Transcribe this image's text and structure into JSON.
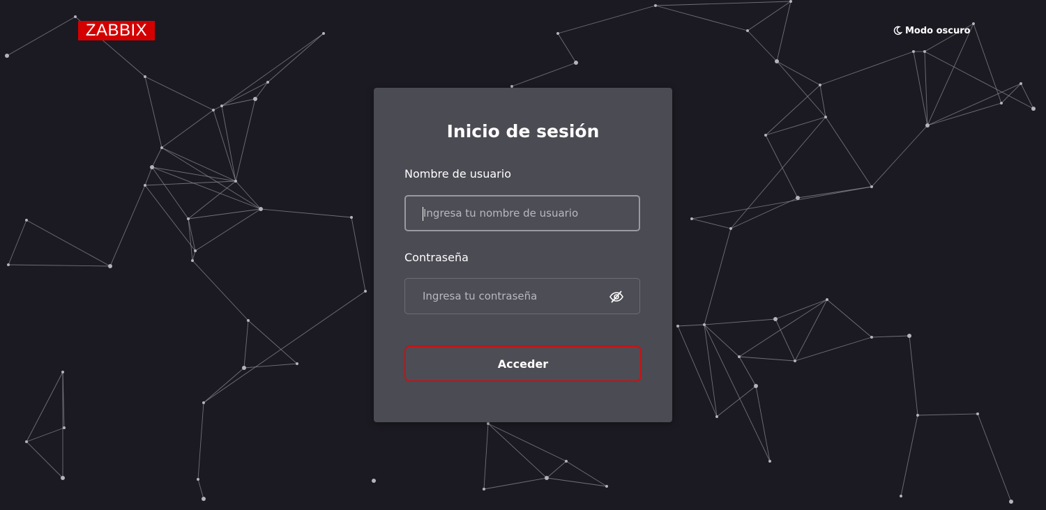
{
  "brand": {
    "logo_text": "ZABBIX",
    "logo_color": "#d40000"
  },
  "header": {
    "mode_label": "Modo oscuro",
    "mode_icon": "moon-icon"
  },
  "login": {
    "title": "Inicio de sesión",
    "username_label": "Nombre de usuario",
    "username_placeholder": "Ingresa tu nombre de usuario",
    "username_value": "",
    "password_label": "Contraseña",
    "password_placeholder": "Ingresa tu contraseña",
    "password_value": "",
    "password_toggle_icon": "eye-slash-icon",
    "submit_label": "Acceder",
    "accent_color": "#cc1010"
  },
  "theme": {
    "background": "#1b1a22",
    "card": "#4b4b53"
  }
}
